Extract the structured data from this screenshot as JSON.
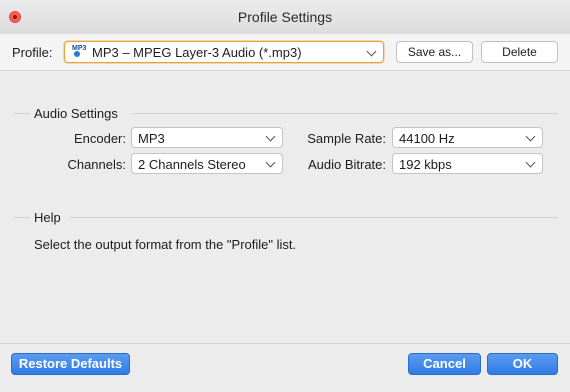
{
  "window": {
    "title": "Profile Settings"
  },
  "profile": {
    "label": "Profile:",
    "value": "MP3 – MPEG Layer-3 Audio (*.mp3)",
    "icon": "mp3-file-icon",
    "icon_text": "MP3",
    "save_as_label": "Save as...",
    "delete_label": "Delete"
  },
  "audio_settings": {
    "header": "Audio Settings",
    "encoder": {
      "label": "Encoder:",
      "value": "MP3"
    },
    "channels": {
      "label": "Channels:",
      "value": "2 Channels Stereo"
    },
    "sample_rate": {
      "label": "Sample Rate:",
      "value": "44100 Hz"
    },
    "audio_bitrate": {
      "label": "Audio Bitrate:",
      "value": "192 kbps"
    }
  },
  "help": {
    "header": "Help",
    "text": "Select the output format from the \"Profile\" list."
  },
  "footer": {
    "restore_label": "Restore Defaults",
    "cancel_label": "Cancel",
    "ok_label": "OK"
  },
  "colors": {
    "accent_blue": "#2f7be6",
    "close_red": "#fc5f57",
    "focus_orange": "#e8a13d"
  }
}
